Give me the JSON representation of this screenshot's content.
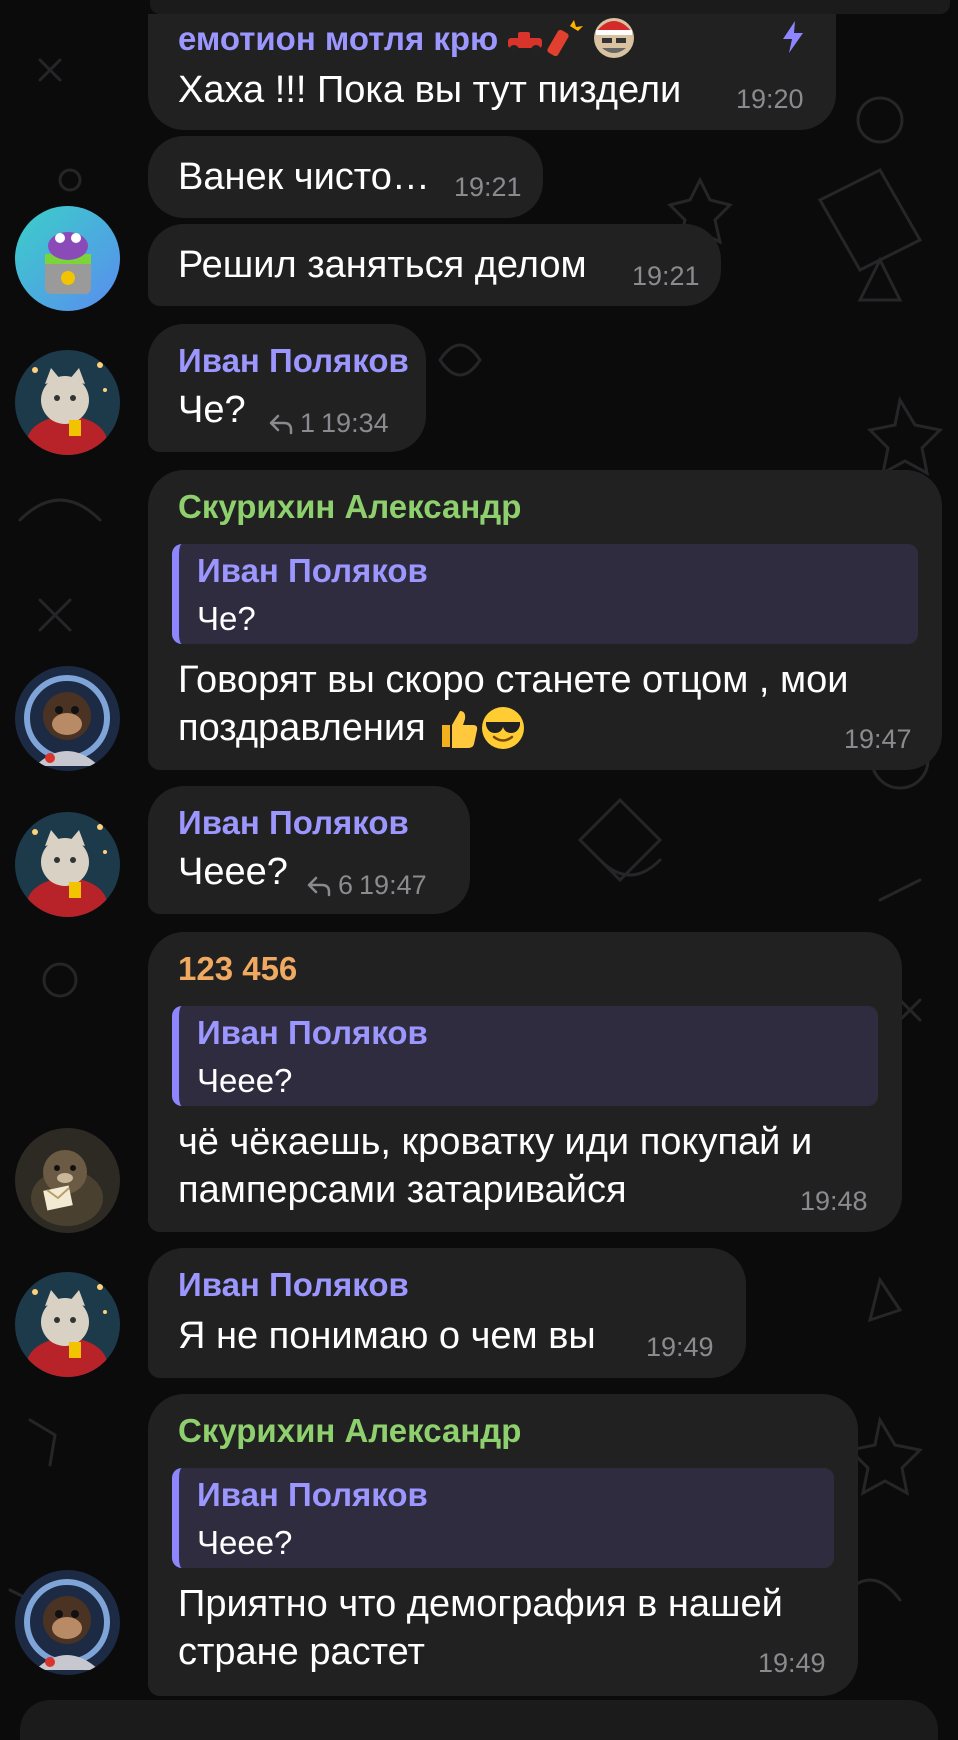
{
  "colors": {
    "bubble": "#212121",
    "background": "#0b0b0c",
    "quote_bg": "#2f2c3f",
    "quote_bar": "#8d86ff",
    "name_purple": "#9c96ff",
    "name_green": "#8fd06e",
    "name_orange": "#f0a960",
    "time": "#8a8a8f"
  },
  "messages": [
    {
      "sender": "емотион мотля крю",
      "text": "Хаха !!! Пока вы тут пиздели",
      "time": "19:20",
      "icons": [
        "race-car-emoji",
        "firecracker-emoji",
        "santa-avatar-emoji",
        "lightning-icon"
      ]
    },
    {
      "text": "Ванек чисто…",
      "time": "19:21"
    },
    {
      "text": "Решил заняться делом",
      "time": "19:21",
      "avatar": "frog-barrel-avatar"
    },
    {
      "sender": "Иван Поляков",
      "text": "Че?",
      "replies": "1",
      "time": "19:34",
      "avatar": "cat-avatar"
    },
    {
      "sender": "Скурихин Александр",
      "quote": {
        "name": "Иван Поляков",
        "text": "Че?"
      },
      "text_lines": [
        "Говорят вы скоро станете отцом , мои",
        "поздравления"
      ],
      "emojis": [
        "thumbs-up-emoji",
        "sunglasses-emoji"
      ],
      "time": "19:47",
      "avatar": "monkey-astronaut-avatar"
    },
    {
      "sender": "Иван Поляков",
      "text": "Чеее?",
      "replies": "6",
      "time": "19:47",
      "avatar": "cat-avatar"
    },
    {
      "sender": "123 456",
      "quote": {
        "name": "Иван Поляков",
        "text": "Чеее?"
      },
      "text_lines": [
        "чё чёкаешь, кроватку иди покупай и",
        "памперсами затаривайся"
      ],
      "time": "19:48",
      "avatar": "otter-avatar"
    },
    {
      "sender": "Иван Поляков",
      "text": "Я не понимаю о чем вы",
      "time": "19:49",
      "avatar": "cat-avatar"
    },
    {
      "sender": "Скурихин Александр",
      "quote": {
        "name": "Иван Поляков",
        "text": "Чеее?"
      },
      "text_lines": [
        "Приятно что демография в нашей",
        "стране растет"
      ],
      "time": "19:49",
      "avatar": "monkey-astronaut-avatar"
    }
  ]
}
